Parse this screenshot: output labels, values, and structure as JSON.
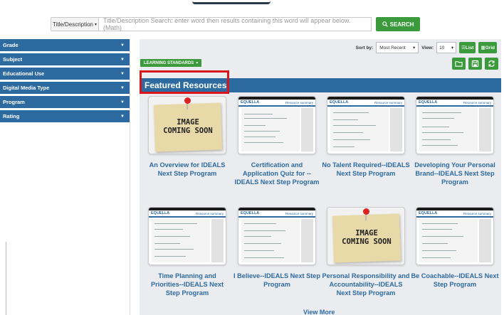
{
  "search": {
    "type_label": "Title/Description",
    "placeholder": "Title/Description Search:  enter word then results containing this word will appear below. (Math)",
    "button_label": "SEARCH"
  },
  "sidebar": {
    "facets": [
      {
        "label": "Grade"
      },
      {
        "label": "Subject"
      },
      {
        "label": "Educational Use"
      },
      {
        "label": "Digital Media Type"
      },
      {
        "label": "Program"
      },
      {
        "label": "Rating"
      }
    ]
  },
  "toolbar": {
    "sort_label": "Sort by:",
    "sort_value": "Most Recent",
    "view_label": "View:",
    "view_value": "10",
    "list_label": "List",
    "grid_label": "Grid",
    "learning_standards": "LEARNING STANDARDS"
  },
  "featured": {
    "title": "Featured Resources"
  },
  "cards": [
    {
      "title": "An Overview for IDEALS Next Step Program",
      "image": "coming-soon"
    },
    {
      "title": "Certification and Application Quiz for --IDEALS Next Step Program",
      "image": "screenshot"
    },
    {
      "title": "No Talent Required--IDEALS Next Step Program",
      "image": "screenshot"
    },
    {
      "title": "Developing Your Personal Brand--IDEALS Next Step Program",
      "image": "screenshot"
    },
    {
      "title": "Time Planning and Priorities--IDEALS Next Step Program",
      "image": "screenshot"
    },
    {
      "title": "I Believe--IDEALS Next Step Program",
      "image": "screenshot"
    },
    {
      "title": "Personal Responsibility and Accountability--IDEALS Next Step Program",
      "image": "coming-soon"
    },
    {
      "title": "Be Coachable--IDEALS Next Step Program",
      "image": "screenshot"
    }
  ],
  "thumb_text": {
    "brand": "EQUELLA",
    "resource_summary": "Resource summary",
    "coming_soon_line1": "IMAGE",
    "coming_soon_line2": "COMING SOON"
  },
  "view_more": "View More",
  "colors": {
    "primary_blue": "#2d6aa0",
    "green": "#3a9a3c",
    "highlight_red": "#d8161b",
    "content_bg": "#eaecef"
  }
}
